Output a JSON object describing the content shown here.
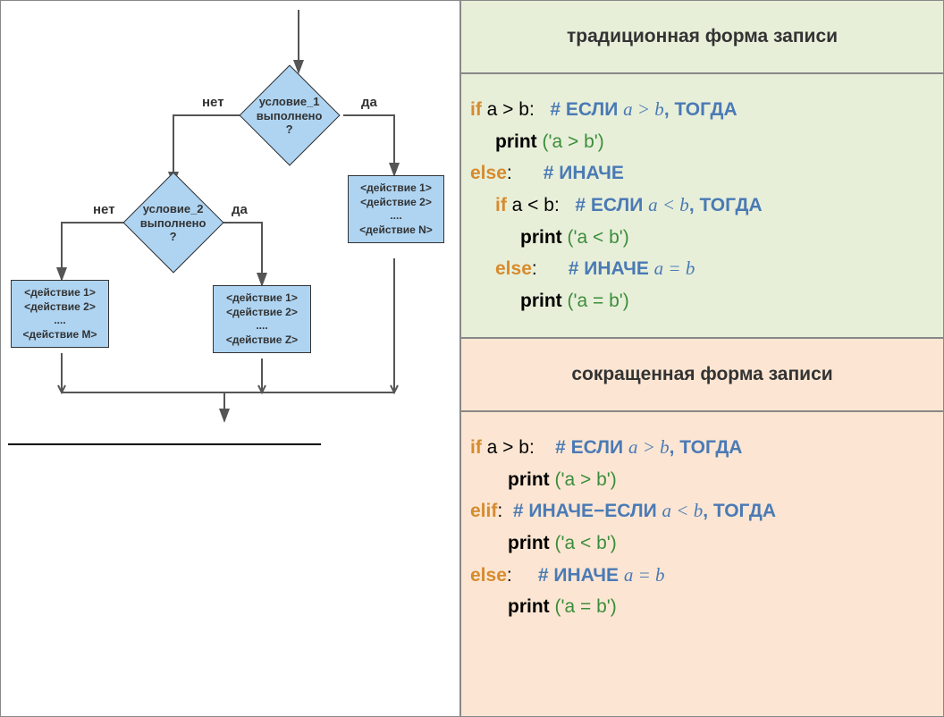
{
  "left": {
    "label_no": "нет",
    "label_yes": "да",
    "diamond1_line1": "условие_1",
    "diamond1_line2": "выполнено",
    "diamond1_line3": "?",
    "diamond2_line1": "условие_2",
    "diamond2_line2": "выполнено",
    "diamond2_line3": "?",
    "box_right_l1": "<действие 1>",
    "box_right_l2": "<действие 2>",
    "box_right_l3": "....",
    "box_right_l4": "<действие N>",
    "box_left_l1": "<действие 1>",
    "box_left_l2": "<действие 2>",
    "box_left_l3": "....",
    "box_left_l4": "<действие M>",
    "box_mid_l1": "<действие 1>",
    "box_mid_l2": "<действие 2>",
    "box_mid_l3": "....",
    "box_mid_l4": "<действие Z>"
  },
  "right": {
    "header_trad": "традиционная форма записи",
    "header_short": "сокращенная форма записи",
    "trad": {
      "l1_if": "if",
      "l1_cond": " a > b:",
      "l1_comment_hash": "# ЕСЛИ ",
      "l1_comment_math": "a  >  b",
      "l1_comment_then": ", ТОГДА",
      "l2_print": "print",
      "l2_arg": " ('a > b')",
      "l3_else": "else",
      "l3_colon": ":",
      "l3_comment": "# ИНАЧЕ",
      "l4_if": "if",
      "l4_cond": " a < b:",
      "l4_comment_hash": "# ЕСЛИ ",
      "l4_comment_math": "a <  b",
      "l4_comment_then": ", ТОГДА",
      "l5_print": "print",
      "l5_arg": " ('a < b')",
      "l6_else": "else",
      "l6_colon": ":",
      "l6_comment_hash": "#  ИНАЧЕ ",
      "l6_comment_math": "a =  b",
      "l7_print": "print",
      "l7_arg": " ('a = b')"
    },
    "short": {
      "l1_if": "if",
      "l1_cond": " a > b:",
      "l1_comment_hash": "# ЕСЛИ ",
      "l1_comment_math": "a  >  b",
      "l1_comment_then": ", ТОГДА",
      "l2_print": "print",
      "l2_arg": " ('a > b')",
      "l3_elif": "elif",
      "l3_colon": ":",
      "l3_comment_hash": "# ИНАЧЕ−ЕСЛИ ",
      "l3_comment_math": "a <  b",
      "l3_comment_then": ", ТОГДА",
      "l4_print": "print",
      "l4_arg": " ('a < b')",
      "l5_else": "else",
      "l5_colon": ":",
      "l5_comment_hash": "#  ИНАЧЕ ",
      "l5_comment_math": "a =  b",
      "l6_print": "print",
      "l6_arg": " ('a = b')"
    }
  }
}
